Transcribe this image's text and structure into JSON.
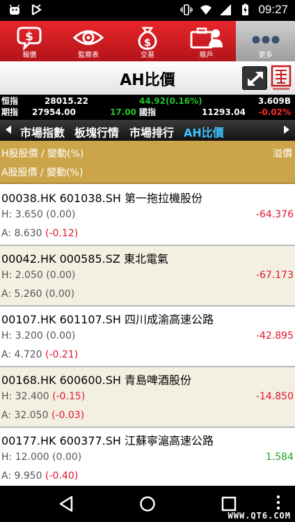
{
  "status_bar": {
    "time": "09:27"
  },
  "nav": {
    "items": [
      {
        "label": "報價",
        "icon": "quote-bubble-icon"
      },
      {
        "label": "監察表",
        "icon": "eye-icon"
      },
      {
        "label": "交易",
        "icon": "money-bag-icon"
      },
      {
        "label": "賬戶",
        "icon": "briefcase-user-icon"
      },
      {
        "label": "更多",
        "icon": "more-dots-icon"
      }
    ],
    "active_index": 4
  },
  "title": "AH比價",
  "ticker": {
    "hsi_label": "恒指",
    "hsi_value": "28015.22",
    "hsi_change": "44.92(0.16%)",
    "turnover": "3.609B",
    "futures_label": "期指",
    "futures_value": "27954.00",
    "futures_change": "17.00",
    "hscei_label": "國指",
    "hscei_value": "11293.04",
    "hscei_change": "-0.02%"
  },
  "tabs": [
    {
      "label": "市場指數"
    },
    {
      "label": "板塊行情"
    },
    {
      "label": "市場排行"
    },
    {
      "label": "AH比價",
      "active": true
    }
  ],
  "columns": {
    "h_label": "H股股價 / 變動(%)",
    "a_label": "A股股價 / 變動(%)",
    "premium_label": "溢價"
  },
  "rows": [
    {
      "name": "00038.HK 601038.SH 第一拖拉機股份",
      "h_price": "3.650",
      "h_change": "(0.00)",
      "h_dir": "flat",
      "a_price": "8.630",
      "a_change": "(-0.12)",
      "a_dir": "down",
      "premium": "-64.376",
      "premium_dir": "down"
    },
    {
      "name": "00042.HK 000585.SZ 東北電氣",
      "h_price": "2.050",
      "h_change": "(0.00)",
      "h_dir": "flat",
      "a_price": "5.260",
      "a_change": "(0.00)",
      "a_dir": "flat",
      "premium": "-67.173",
      "premium_dir": "down"
    },
    {
      "name": "00107.HK 601107.SH 四川成渝高速公路",
      "h_price": "3.200",
      "h_change": "(0.00)",
      "h_dir": "flat",
      "a_price": "4.720",
      "a_change": "(-0.21)",
      "a_dir": "down",
      "premium": "-42.895",
      "premium_dir": "down"
    },
    {
      "name": "00168.HK 600600.SH 青島啤酒股份",
      "h_price": "32.400",
      "h_change": "(-0.15)",
      "h_dir": "down",
      "a_price": "32.050",
      "a_change": "(-0.03)",
      "a_dir": "down",
      "premium": "-14.850",
      "premium_dir": "down"
    },
    {
      "name": "00177.HK 600377.SH 江蘇寧滬高速公路",
      "h_price": "12.000",
      "h_change": "(0.00)",
      "h_dir": "flat",
      "a_price": "9.950",
      "a_change": "(-0.40)",
      "a_dir": "down",
      "premium": "1.584",
      "premium_dir": "up"
    }
  ],
  "row_prefix": {
    "h": "H: ",
    "a": "A: "
  },
  "watermark": "WWW.QT6.COM",
  "colors": {
    "brand_red": "#d81e25",
    "header_gold": "#cca54a",
    "active_tab": "#3dc3ff",
    "up": "#1aa52a",
    "down": "#e0162b"
  }
}
